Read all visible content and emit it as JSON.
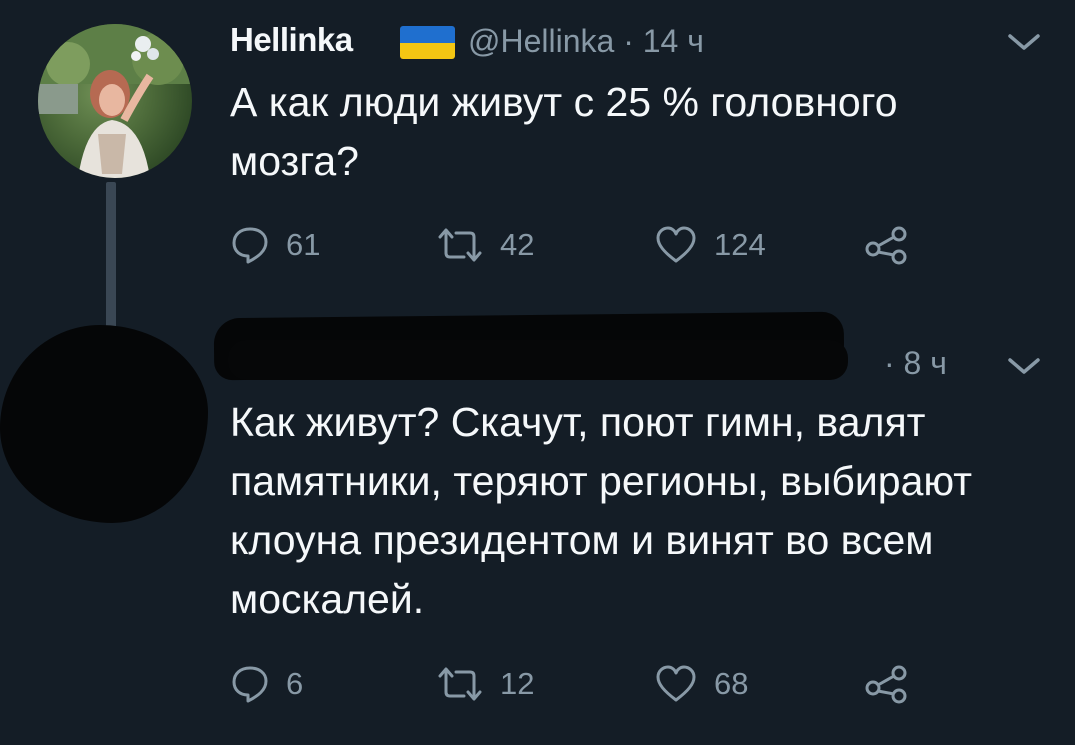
{
  "tweets": [
    {
      "author_name": "Hellinka",
      "author_handle": "@Hellinka",
      "time": "· 14 ч",
      "text": "А как люди живут с 25 % головного мозга?",
      "reply_count": "61",
      "retweet_count": "42",
      "like_count": "124",
      "flag_colors": [
        "#1f6fcf",
        "#f3c613"
      ]
    },
    {
      "time": "· 8 ч",
      "text": "Как живут? Скачут, поют гимн,  валят памятники, теряют регионы, выбирают клоуна президентом и винят во всем москалей.",
      "reply_count": "6",
      "retweet_count": "12",
      "like_count": "68"
    }
  ],
  "icons": [
    "chevron-down-icon",
    "reply-icon",
    "retweet-icon",
    "like-icon",
    "share-icon"
  ],
  "colors": {
    "background": "#141d26",
    "text_primary": "#f5f8fa",
    "text_secondary": "#8899a6",
    "thread_line": "#3a4754"
  }
}
